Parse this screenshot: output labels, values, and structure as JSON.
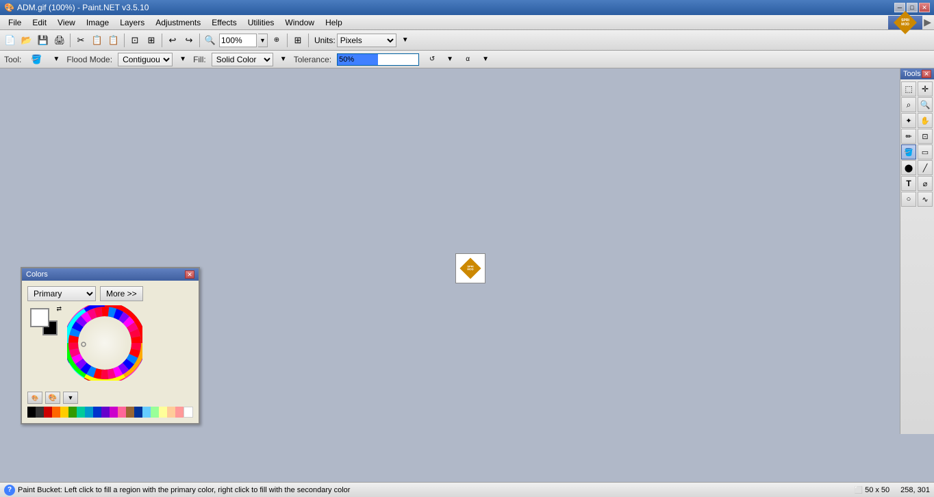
{
  "titleBar": {
    "title": "ADM.gif (100%) - Paint.NET v3.5.10",
    "minBtn": "─",
    "maxBtn": "□",
    "closeBtn": "✕"
  },
  "menuBar": {
    "items": [
      {
        "label": "File",
        "id": "file"
      },
      {
        "label": "Edit",
        "id": "edit"
      },
      {
        "label": "View",
        "id": "view"
      },
      {
        "label": "Image",
        "id": "image"
      },
      {
        "label": "Layers",
        "id": "layers"
      },
      {
        "label": "Adjustments",
        "id": "adjustments"
      },
      {
        "label": "Effects",
        "id": "effects"
      },
      {
        "label": "Utilities",
        "id": "utilities"
      },
      {
        "label": "Window",
        "id": "window"
      },
      {
        "label": "Help",
        "id": "help"
      }
    ]
  },
  "toolbar": {
    "zoom": "100%",
    "units_label": "Units:",
    "units_value": "Pixels"
  },
  "toolOptions": {
    "tool_label": "Tool:",
    "flood_mode_label": "Flood Mode:",
    "fill_label": "Fill:",
    "fill_value": "Solid Color",
    "tolerance_label": "Tolerance:",
    "tolerance_value": "50%",
    "tolerance_percent": 50
  },
  "colorsPanel": {
    "title": "Colors",
    "closeBtn": "✕",
    "primaryLabel": "Primary",
    "moreBtn": "More >>",
    "primaryColor": "#ffffff",
    "secondaryColor": "#000000"
  },
  "toolsPanel": {
    "title": "Tools",
    "closeBtn": "✕",
    "tools": [
      {
        "icon": "↖",
        "name": "rectangle-select"
      },
      {
        "icon": "✋",
        "name": "move"
      },
      {
        "icon": "⌕",
        "name": "zoom-in"
      },
      {
        "icon": "🔍",
        "name": "zoom-out"
      },
      {
        "icon": "↗",
        "name": "magic-wand"
      },
      {
        "icon": "⊕",
        "name": "pan"
      },
      {
        "icon": "✏",
        "name": "pencil"
      },
      {
        "icon": "⬜",
        "name": "eraser"
      },
      {
        "icon": "🪣",
        "name": "fill"
      },
      {
        "icon": "▣",
        "name": "rectangle"
      },
      {
        "icon": "✒",
        "name": "brush"
      },
      {
        "icon": "∕",
        "name": "line"
      },
      {
        "icon": "T",
        "name": "text"
      },
      {
        "icon": "⟋",
        "name": "shape"
      },
      {
        "icon": "◯",
        "name": "ellipse"
      },
      {
        "icon": "⟿",
        "name": "freeform"
      }
    ]
  },
  "colorPalette": [
    "#000000",
    "#333333",
    "#666666",
    "#999999",
    "#cccccc",
    "#ffffff",
    "#ff0000",
    "#ff6600",
    "#ffcc00",
    "#ffff00",
    "#99ff00",
    "#00ff00",
    "#00ffcc",
    "#00ccff",
    "#0066ff",
    "#0000ff",
    "#6600ff",
    "#cc00ff",
    "#ff00cc",
    "#ff0066"
  ],
  "statusBar": {
    "text": "Paint Bucket: Left click to fill a region with the primary color, right click to fill with the secondary color",
    "iconLabel": "?",
    "size": "50 x 50",
    "coords": "258, 301"
  }
}
